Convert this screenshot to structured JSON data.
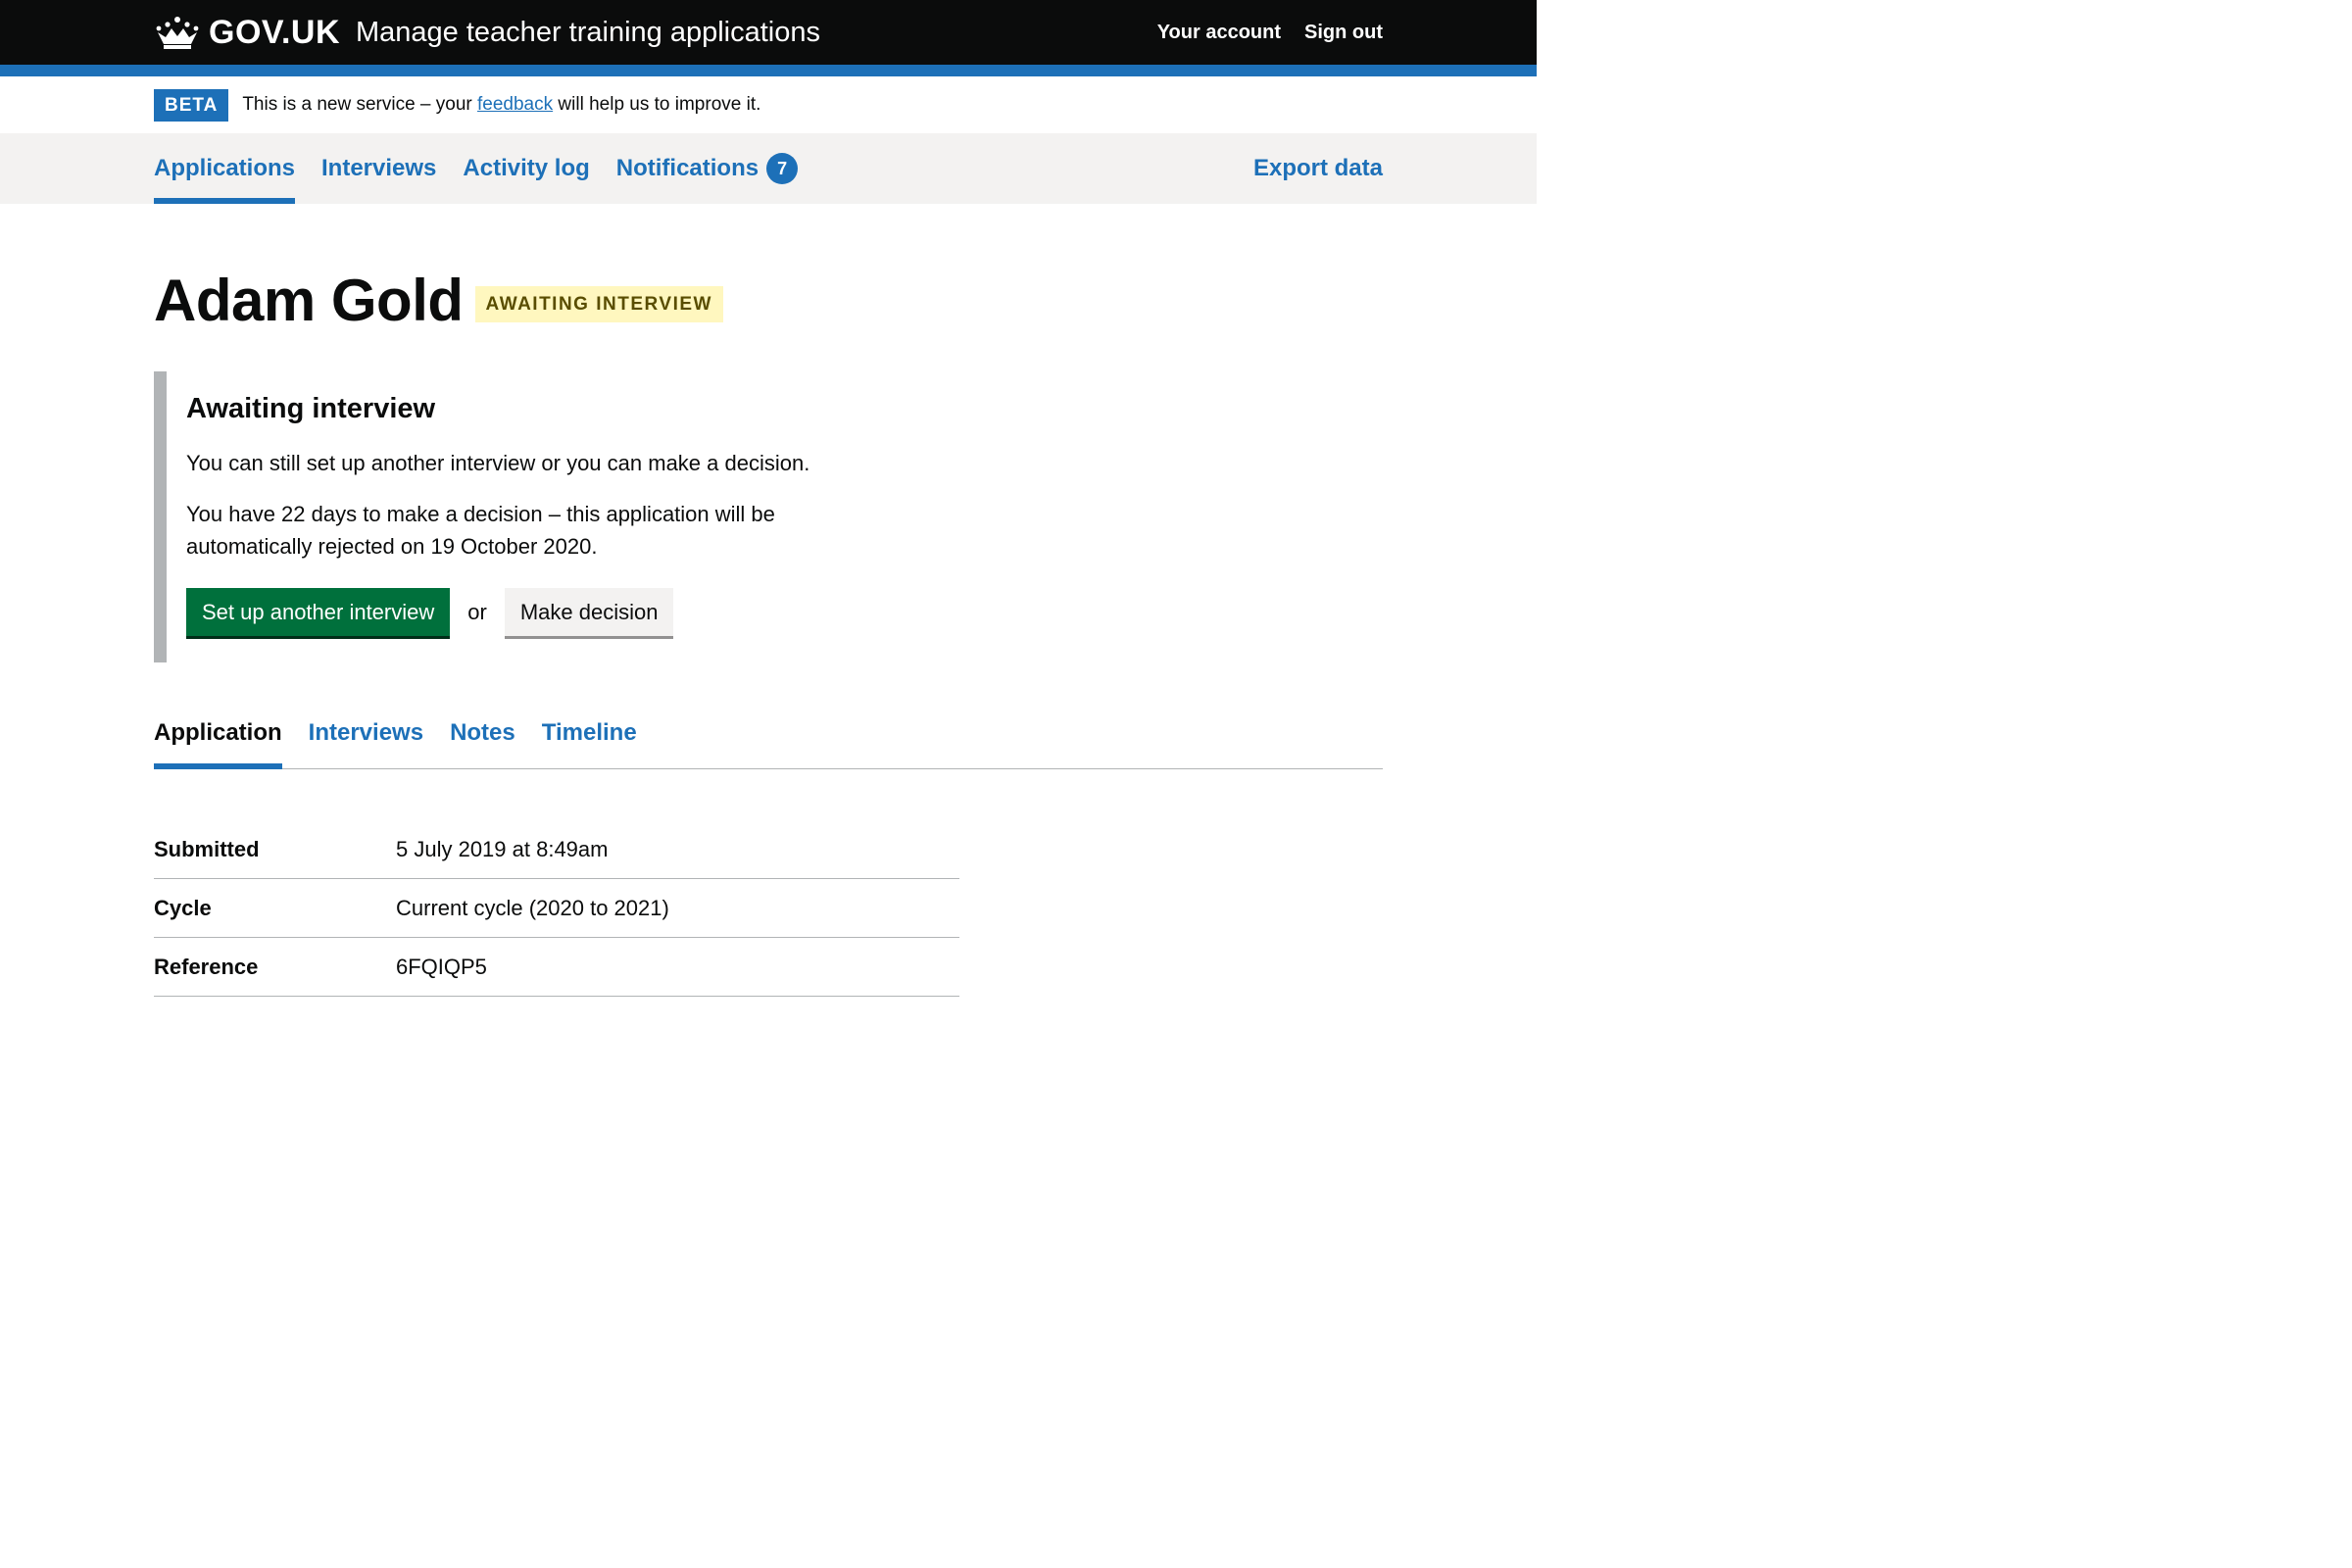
{
  "header": {
    "logo_text": "GOV.UK",
    "service_name": "Manage teacher training applications",
    "nav": [
      "Your account",
      "Sign out"
    ]
  },
  "phase": {
    "tag": "BETA",
    "text_before": "This is a new service – your ",
    "link_text": "feedback",
    "text_after": " will help us to improve it."
  },
  "primary_nav": {
    "items": [
      {
        "label": "Applications",
        "active": true
      },
      {
        "label": "Interviews"
      },
      {
        "label": "Activity log"
      },
      {
        "label": "Notifications",
        "badge": "7"
      }
    ],
    "right_item": "Export data"
  },
  "page": {
    "title": "Adam Gold",
    "status": "AWAITING INTERVIEW"
  },
  "inset": {
    "heading": "Awaiting interview",
    "para1": "You can still set up another interview or you can make a decision.",
    "para2": "You have 22 days to make a decision – this application will be automatically rejected on 19 October 2020.",
    "primary_button": "Set up another interview",
    "or": "or",
    "secondary_button": "Make decision"
  },
  "sub_tabs": [
    {
      "label": "Application",
      "active": true
    },
    {
      "label": "Interviews"
    },
    {
      "label": "Notes"
    },
    {
      "label": "Timeline"
    }
  ],
  "summary": [
    {
      "key": "Submitted",
      "value": "5 July 2019 at 8:49am"
    },
    {
      "key": "Cycle",
      "value": "Current cycle (2020 to 2021)"
    },
    {
      "key": "Reference",
      "value": "6FQIQP5"
    }
  ],
  "colors": {
    "brand_blue": "#1d70b8",
    "header_black": "#0b0c0c",
    "button_green": "#00703c",
    "status_yellow_bg": "#fff7bf"
  }
}
